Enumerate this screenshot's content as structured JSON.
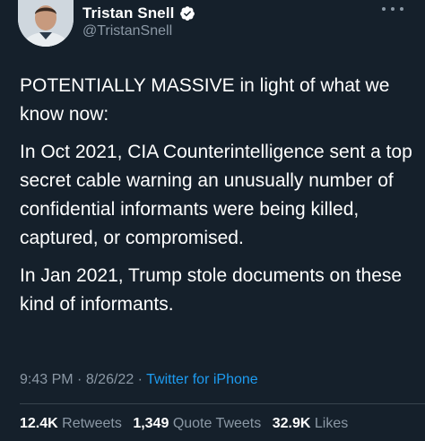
{
  "author": {
    "name": "Tristan Snell",
    "handle": "@TristanSnell"
  },
  "tweet": {
    "paragraphs": [
      "POTENTIALLY MASSIVE in light of what we know now:",
      "In Oct 2021, CIA Counterintelligence sent a top secret cable warning an unusually number of confidential informants were being killed, captured, or compromised.",
      "In Jan 2021, Trump stole documents on these kind of informants."
    ]
  },
  "meta": {
    "time": "9:43 PM",
    "date": "8/26/22",
    "source": "Twitter for iPhone",
    "separator": "·"
  },
  "stats": {
    "retweets_count": "12.4K",
    "retweets_label": "Retweets",
    "quotes_count": "1,349",
    "quotes_label": "Quote Tweets",
    "likes_count": "32.9K",
    "likes_label": "Likes"
  },
  "colors": {
    "background": "#15202b",
    "text": "#ffffff",
    "secondary": "#8b98a5",
    "accent": "#1d9bf0"
  }
}
